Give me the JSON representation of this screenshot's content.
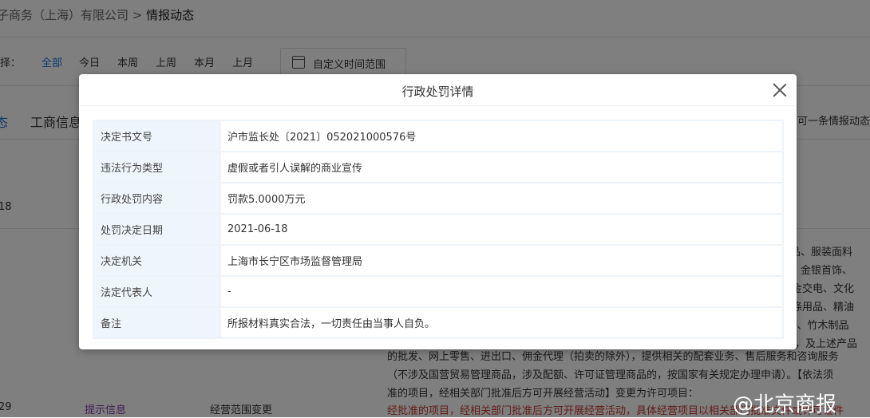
{
  "breadcrumb": {
    "company": "子商务（上海）有限公司",
    "separator": ">",
    "current": "情报动态"
  },
  "filter": {
    "label": "择：",
    "options": [
      "全部",
      "今日",
      "本周",
      "上周",
      "本月",
      "上月"
    ],
    "active": "全部",
    "custom_range": "自定义时间范围"
  },
  "tabs": [
    "态",
    "工商信息"
  ],
  "right_hint": "可一条情报动态",
  "rows_bg": [
    {
      "date": "18"
    },
    {
      "date": "29",
      "type": "提示信息",
      "title": "经营范围变更"
    }
  ],
  "desc_fragments": [
    "品、服装面料",
    "、金银首饰、",
    "金交电、文化",
    "涤用品、精油",
    "）、竹木制品",
    "，及上述产品"
  ],
  "desc_lines": [
    "的批发、网上零售、进出口、佣金代理（拍卖的除外），提供相关的配套业务、售后服务和咨询服务",
    "（不涉及国营贸易管理商品，涉及配额、许可证管理商品的，按国家有关规定办理申请）。【依法须",
    "准的项目，经相关部门批准后方可开展经营活动】变更为许可项目：",
    "经批准的项目，经相关部门批准后方可开展经营活动，具体经营项目以相关部门批准文件或许可证件"
  ],
  "watermark": "@北京商报",
  "modal": {
    "title": "行政处罚详情",
    "rows": [
      {
        "label": "决定书文号",
        "value": "沪市监长处〔2021〕052021000576号"
      },
      {
        "label": "违法行为类型",
        "value": "虚假或者引人误解的商业宣传"
      },
      {
        "label": "行政处罚内容",
        "value": "罚款5.0000万元"
      },
      {
        "label": "处罚决定日期",
        "value": "2021-06-18"
      },
      {
        "label": "决定机关",
        "value": "上海市长宁区市场监督管理局"
      },
      {
        "label": "法定代表人",
        "value": "-"
      },
      {
        "label": "备注",
        "value": "所报材料真实合法，一切责任由当事人自负。"
      }
    ]
  },
  "colors": {
    "accent": "#1e6fd9",
    "overlay": "rgba(0,0,0,0.5)",
    "label_bg": "#eef5fc"
  }
}
